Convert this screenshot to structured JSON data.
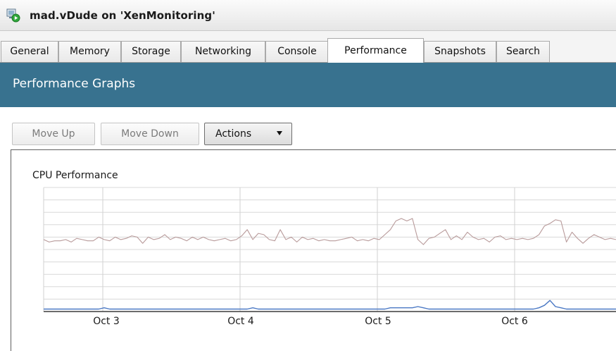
{
  "window": {
    "title": "mad.vDude on 'XenMonitoring'",
    "icon": "vm-running-icon"
  },
  "tabs": [
    {
      "label": "General",
      "active": false
    },
    {
      "label": "Memory",
      "active": false
    },
    {
      "label": "Storage",
      "active": false
    },
    {
      "label": "Networking",
      "active": false
    },
    {
      "label": "Console",
      "active": false
    },
    {
      "label": "Performance",
      "active": true
    },
    {
      "label": "Snapshots",
      "active": false
    },
    {
      "label": "Search",
      "active": false
    }
  ],
  "header": {
    "title": "Performance Graphs",
    "background_color": "#38728f"
  },
  "toolbar": {
    "move_up_label": "Move Up",
    "move_down_label": "Move Down",
    "actions_label": "Actions",
    "move_up_enabled": false,
    "move_down_enabled": false
  },
  "chart_data": {
    "type": "line",
    "title": "CPU Performance",
    "x_tick_labels": [
      "Oct 3",
      "Oct 4",
      "Oct 5",
      "Oct 6"
    ],
    "grid": true,
    "series": [
      {
        "color": "#b89a9a",
        "values": [
          58,
          56,
          57,
          57,
          58,
          56,
          59,
          58,
          57,
          57,
          60,
          58,
          57,
          60,
          58,
          59,
          61,
          60,
          55,
          60,
          58,
          59,
          62,
          58,
          60,
          59,
          57,
          60,
          58,
          60,
          58,
          57,
          58,
          59,
          57,
          58,
          61,
          66,
          58,
          63,
          62,
          58,
          57,
          66,
          58,
          60,
          56,
          60,
          58,
          59,
          57,
          58,
          57,
          57,
          58,
          59,
          60,
          57,
          58,
          57,
          59,
          58,
          62,
          66,
          73,
          75,
          73,
          75,
          58,
          54,
          59,
          60,
          63,
          66,
          58,
          61,
          58,
          64,
          60,
          58,
          59,
          56,
          60,
          61,
          58,
          59,
          58,
          59,
          58,
          59,
          62,
          69,
          71,
          74,
          73,
          56,
          64,
          59,
          55,
          59,
          62,
          60,
          58,
          59,
          58
        ]
      },
      {
        "color": "#4a78c4",
        "values": [
          2,
          2,
          2,
          2,
          2,
          2,
          2,
          2,
          2,
          2,
          2,
          3,
          2,
          2,
          2,
          2,
          2,
          2,
          2,
          2,
          2,
          2,
          2,
          2,
          2,
          2,
          2,
          2,
          2,
          2,
          2,
          2,
          2,
          2,
          2,
          2,
          2,
          2,
          3,
          2,
          2,
          2,
          2,
          2,
          2,
          2,
          2,
          2,
          2,
          2,
          2,
          2,
          2,
          2,
          2,
          2,
          2,
          2,
          2,
          2,
          2,
          2,
          2,
          3,
          3,
          3,
          3,
          3,
          4,
          3,
          2,
          2,
          2,
          2,
          2,
          2,
          2,
          2,
          2,
          2,
          2,
          2,
          2,
          2,
          2,
          2,
          2,
          2,
          2,
          2,
          3,
          5,
          9,
          4,
          3,
          2,
          2,
          2,
          2,
          2,
          2,
          2,
          2,
          2,
          2
        ]
      }
    ],
    "ylim": [
      0,
      100
    ]
  }
}
